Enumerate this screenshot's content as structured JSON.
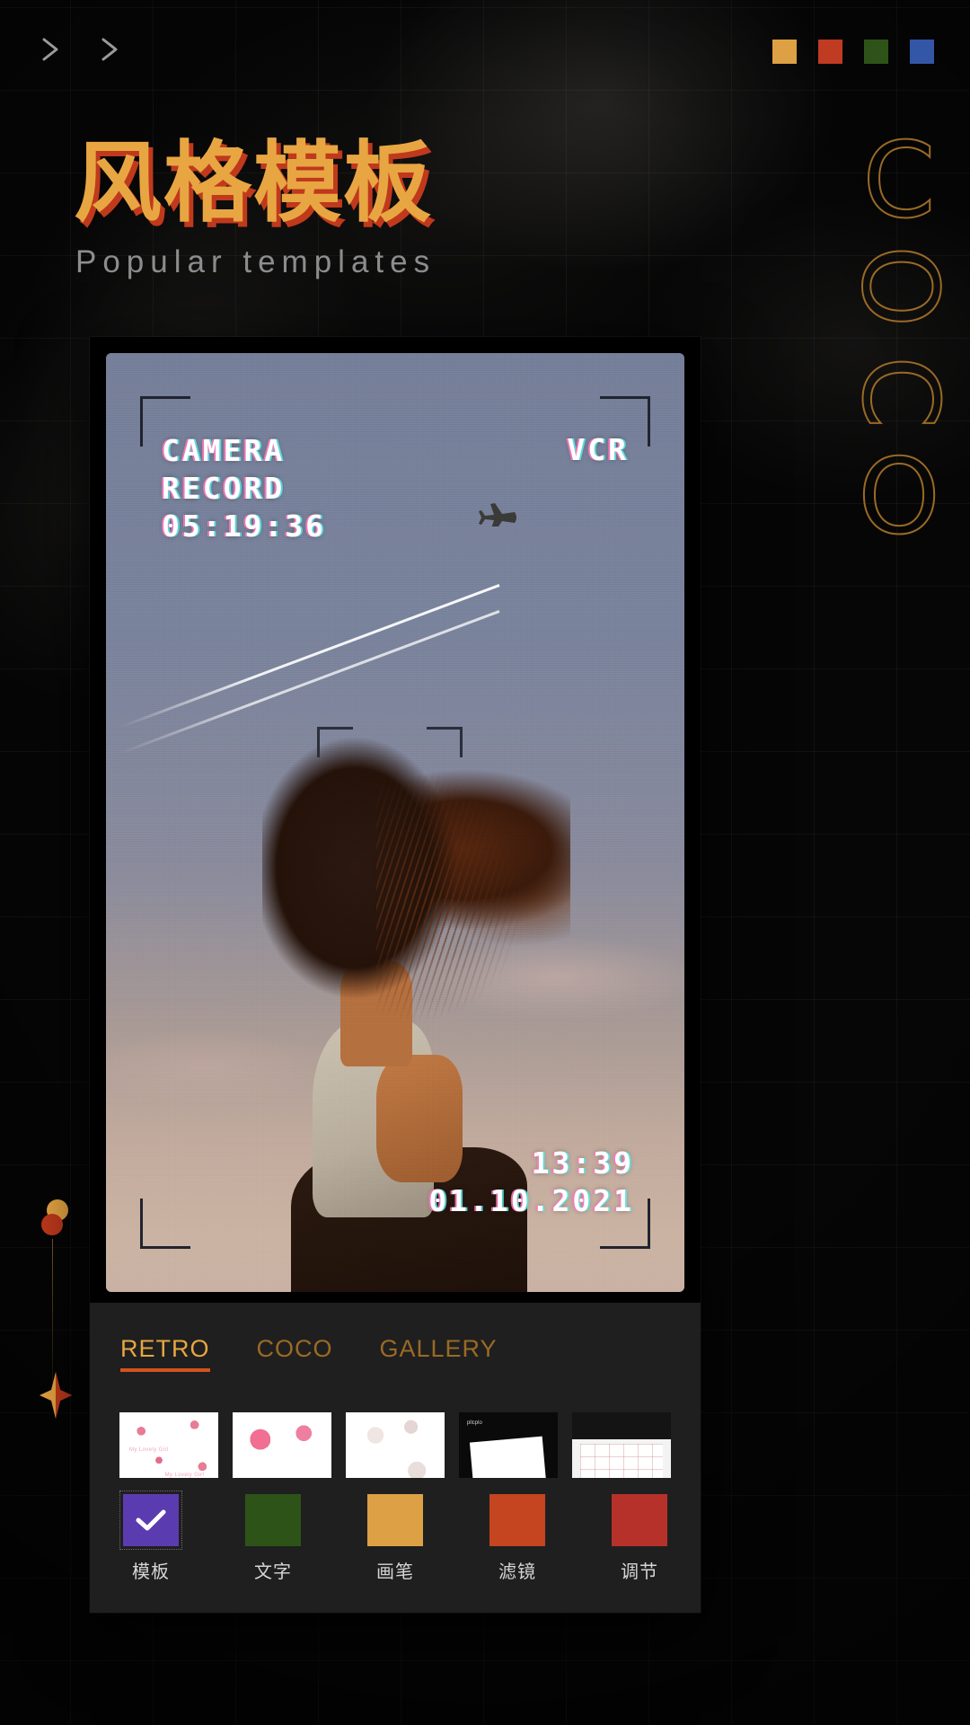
{
  "page": {
    "title_cn": "风格模板",
    "title_en": "Popular templates",
    "side_letters": [
      "C",
      "O",
      "C",
      "O"
    ]
  },
  "topbar": {
    "nav": [
      {
        "name": "chevron-right-icon-1",
        "glyph": ">"
      },
      {
        "name": "chevron-right-icon-2",
        "glyph": ">"
      }
    ],
    "swatches": [
      {
        "name": "swatch-amber",
        "color": "#DDA044"
      },
      {
        "name": "swatch-red",
        "color": "#BF3B22"
      },
      {
        "name": "swatch-green",
        "color": "#2E5318"
      },
      {
        "name": "swatch-blue",
        "color": "#3456A6"
      }
    ]
  },
  "preview": {
    "overlay_left": [
      "CAMERA",
      "RECORD",
      "05:19:36"
    ],
    "overlay_right": "VCR",
    "overlay_bottom": [
      "13:39",
      "01.10.2021"
    ]
  },
  "tabs": [
    {
      "label": "RETRO",
      "active": true
    },
    {
      "label": "COCO",
      "active": false
    },
    {
      "label": "GALLERY",
      "active": false
    }
  ],
  "thumbnails": [
    {
      "name": "template-thumb-hearts-small",
      "caption": "My Lovely Girl"
    },
    {
      "name": "template-thumb-hearts-large",
      "caption": ""
    },
    {
      "name": "template-thumb-pearls",
      "caption": ""
    },
    {
      "name": "template-thumb-poster-dark",
      "caption": "pllcplo"
    },
    {
      "name": "template-thumb-grid-white",
      "caption": ""
    }
  ],
  "toolbar": [
    {
      "label": "模板",
      "color": "#5B3CB0",
      "icon": "check-icon",
      "selected": true
    },
    {
      "label": "文字",
      "color": "#2E5318",
      "icon": "text-icon",
      "selected": false
    },
    {
      "label": "画笔",
      "color": "#DDA044",
      "icon": "brush-icon",
      "selected": false
    },
    {
      "label": "滤镜",
      "color": "#C4451F",
      "icon": "filter-icon",
      "selected": false
    },
    {
      "label": "调节",
      "color": "#B7312B",
      "icon": "adjust-icon",
      "selected": false
    }
  ],
  "theme": {
    "accent_orange": "#E8A642",
    "accent_red": "#C0391C",
    "panel_bg": "#1F1F1F",
    "page_bg": "#060606"
  }
}
